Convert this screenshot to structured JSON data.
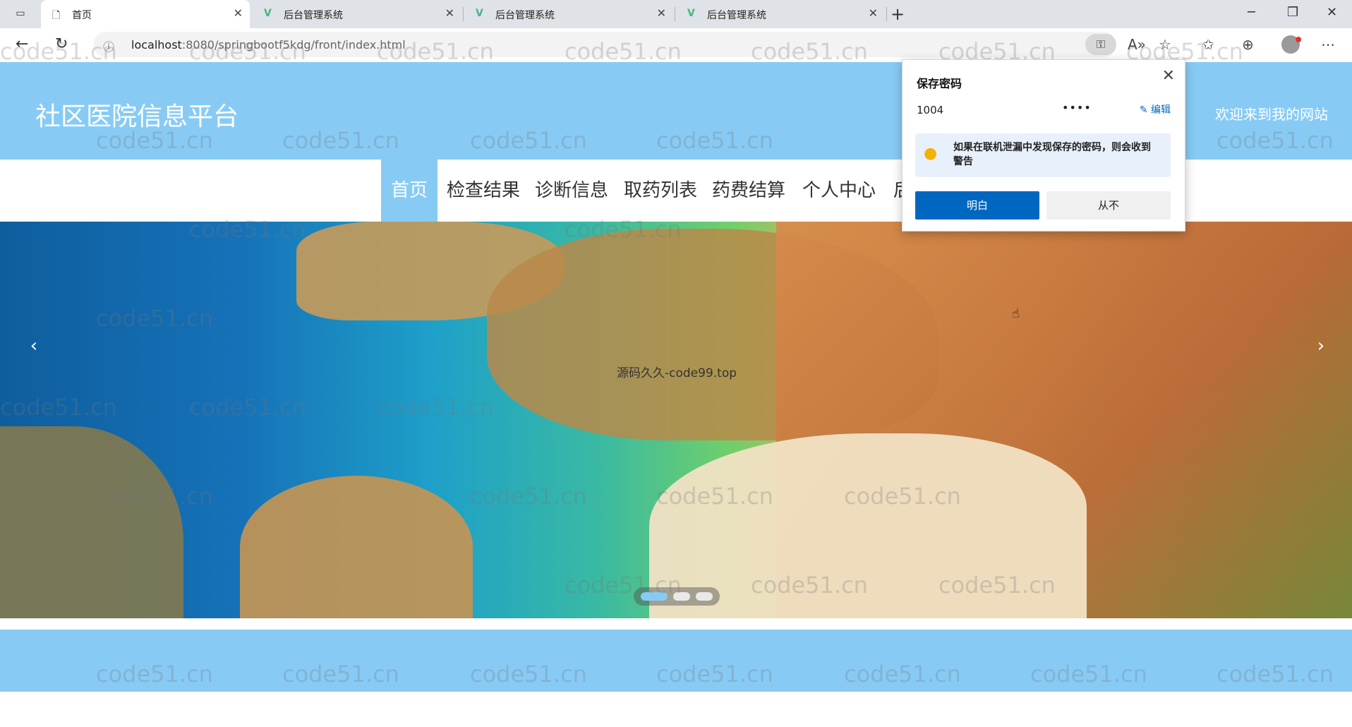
{
  "browser": {
    "tabs": [
      {
        "title": "首页",
        "icon": "page-icon",
        "active": true
      },
      {
        "title": "后台管理系统",
        "icon": "vue-icon",
        "active": false
      },
      {
        "title": "后台管理系统",
        "icon": "vue-icon",
        "active": false
      },
      {
        "title": "后台管理系统",
        "icon": "vue-icon",
        "active": false
      }
    ],
    "url_host": "localhost",
    "url_rest": ":8080/springbootf5kdg/front/index.html"
  },
  "site": {
    "title": "社区医院信息平台",
    "welcome": "欢迎来到我的网站"
  },
  "nav": {
    "items": [
      "首页",
      "检查结果",
      "诊断信息",
      "取药列表",
      "药费结算",
      "个人中心",
      "后"
    ]
  },
  "banner": {
    "center_text": "源码久久-code99.top",
    "slides": 3,
    "active_slide": 1
  },
  "watermark": "code51.cn",
  "password_popup": {
    "title": "保存密码",
    "username": "1004",
    "password_mask": "••••",
    "edit_label": "编辑",
    "warning": "如果在联机泄漏中发现保存的密码，则会收到警告",
    "ok_label": "明白",
    "never_label": "从不"
  },
  "colors": {
    "accent": "#87cbf5",
    "primary_button": "#0067c0"
  }
}
